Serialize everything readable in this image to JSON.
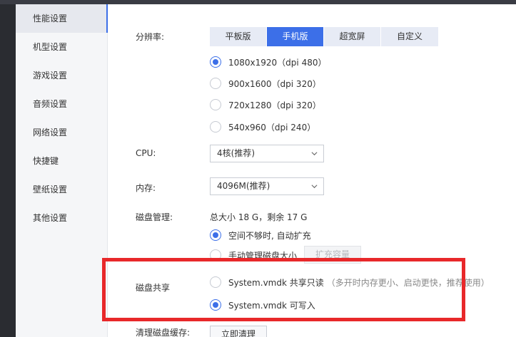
{
  "sidebar": {
    "items": [
      {
        "label": "性能设置",
        "active": true
      },
      {
        "label": "机型设置"
      },
      {
        "label": "游戏设置"
      },
      {
        "label": "音频设置"
      },
      {
        "label": "网络设置"
      },
      {
        "label": "快捷键"
      },
      {
        "label": "壁纸设置"
      },
      {
        "label": "其他设置"
      }
    ]
  },
  "resolution": {
    "label": "分辨率:",
    "tabs": [
      {
        "label": "平板版"
      },
      {
        "label": "手机版",
        "active": true
      },
      {
        "label": "超宽屏"
      },
      {
        "label": "自定义"
      }
    ],
    "options": [
      {
        "label": "1080x1920（dpi 480）",
        "selected": true
      },
      {
        "label": "900x1600（dpi 320）"
      },
      {
        "label": "720x1280（dpi 320）"
      },
      {
        "label": "540x960（dpi 240）"
      }
    ]
  },
  "cpu": {
    "label": "CPU:",
    "value": "4核(推荐)"
  },
  "memory": {
    "label": "内存:",
    "value": "4096M(推荐)"
  },
  "disk": {
    "label": "磁盘管理:",
    "summary": "总大小 18 G，剩余 17 G",
    "options": [
      {
        "label": "空间不够时, 自动扩充",
        "selected": true
      },
      {
        "label": "手动管理磁盘大小"
      }
    ],
    "expand_button": "扩充容量"
  },
  "disk_share": {
    "label": "磁盘共享",
    "options": [
      {
        "label": "System.vmdk 共享只读",
        "hint": "（多开时内存更小、启动更快，推荐使用）"
      },
      {
        "label": "System.vmdk 可写入",
        "selected": true
      }
    ]
  },
  "cache": {
    "label": "清理磁盘缓存:",
    "button": "立即清理"
  },
  "colors": {
    "accent": "#3c6fe8",
    "highlight_frame": "#e8282a"
  }
}
